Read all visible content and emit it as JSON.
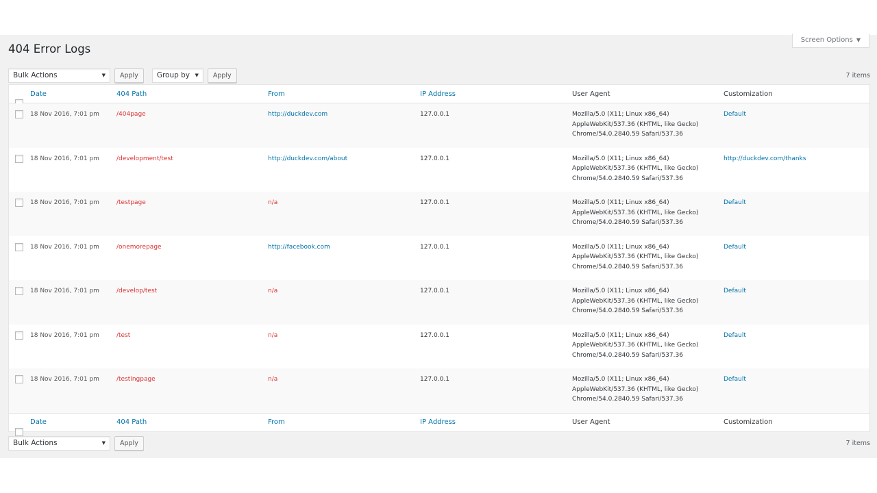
{
  "screen_options": {
    "label": "Screen Options",
    "arrow": "▼"
  },
  "page": {
    "title": "404 Error Logs"
  },
  "tablenav_top": {
    "bulk_actions": "Bulk Actions",
    "apply": "Apply",
    "group_by": "Group by",
    "apply2": "Apply",
    "count": "7 items"
  },
  "tablenav_bottom": {
    "bulk_actions": "Bulk Actions",
    "apply": "Apply",
    "count": "7 items"
  },
  "columns": {
    "date": "Date",
    "path": "404 Path",
    "from": "From",
    "ip": "IP Address",
    "ua": "User Agent",
    "cust": "Customization"
  },
  "rows": [
    {
      "date": "18 Nov 2016, 7:01 pm",
      "path": "/404page",
      "from": "http://duckdev.com",
      "ip": "127.0.0.1",
      "ua": [
        "Mozilla/5.0 (X11; Linux x86_64)",
        "AppleWebKit/537.36 (KHTML, like Gecko)",
        "Chrome/54.0.2840.59 Safari/537.36"
      ],
      "cust": "Default"
    },
    {
      "date": "18 Nov 2016, 7:01 pm",
      "path": "/development/test",
      "from": "http://duckdev.com/about",
      "ip": "127.0.0.1",
      "ua": [
        "Mozilla/5.0 (X11; Linux x86_64)",
        "AppleWebKit/537.36 (KHTML, like Gecko)",
        "Chrome/54.0.2840.59 Safari/537.36"
      ],
      "cust": "http://duckdev.com/thanks"
    },
    {
      "date": "18 Nov 2016, 7:01 pm",
      "path": "/testpage",
      "from": "n/a",
      "ip": "127.0.0.1",
      "ua": [
        "Mozilla/5.0 (X11; Linux x86_64)",
        "AppleWebKit/537.36 (KHTML, like Gecko)",
        "Chrome/54.0.2840.59 Safari/537.36"
      ],
      "cust": "Default"
    },
    {
      "date": "18 Nov 2016, 7:01 pm",
      "path": "/onemorepage",
      "from": "http://facebook.com",
      "ip": "127.0.0.1",
      "ua": [
        "Mozilla/5.0 (X11; Linux x86_64)",
        "AppleWebKit/537.36 (KHTML, like Gecko)",
        "Chrome/54.0.2840.59 Safari/537.36"
      ],
      "cust": "Default"
    },
    {
      "date": "18 Nov 2016, 7:01 pm",
      "path": "/develop/test",
      "from": "n/a",
      "ip": "127.0.0.1",
      "ua": [
        "Mozilla/5.0 (X11; Linux x86_64)",
        "AppleWebKit/537.36 (KHTML, like Gecko)",
        "Chrome/54.0.2840.59 Safari/537.36"
      ],
      "cust": "Default"
    },
    {
      "date": "18 Nov 2016, 7:01 pm",
      "path": "/test",
      "from": "n/a",
      "ip": "127.0.0.1",
      "ua": [
        "Mozilla/5.0 (X11; Linux x86_64)",
        "AppleWebKit/537.36 (KHTML, like Gecko)",
        "Chrome/54.0.2840.59 Safari/537.36"
      ],
      "cust": "Default"
    },
    {
      "date": "18 Nov 2016, 7:01 pm",
      "path": "/testingpage",
      "from": "n/a",
      "ip": "127.0.0.1",
      "ua": [
        "Mozilla/5.0 (X11; Linux x86_64)",
        "AppleWebKit/537.36 (KHTML, like Gecko)",
        "Chrome/54.0.2840.59 Safari/537.36"
      ],
      "cust": "Default"
    }
  ],
  "colors": {
    "link": "#0073aa",
    "error_path": "#dc3232",
    "alt_row": "#f9f9f9",
    "background": "#f1f1f1"
  }
}
